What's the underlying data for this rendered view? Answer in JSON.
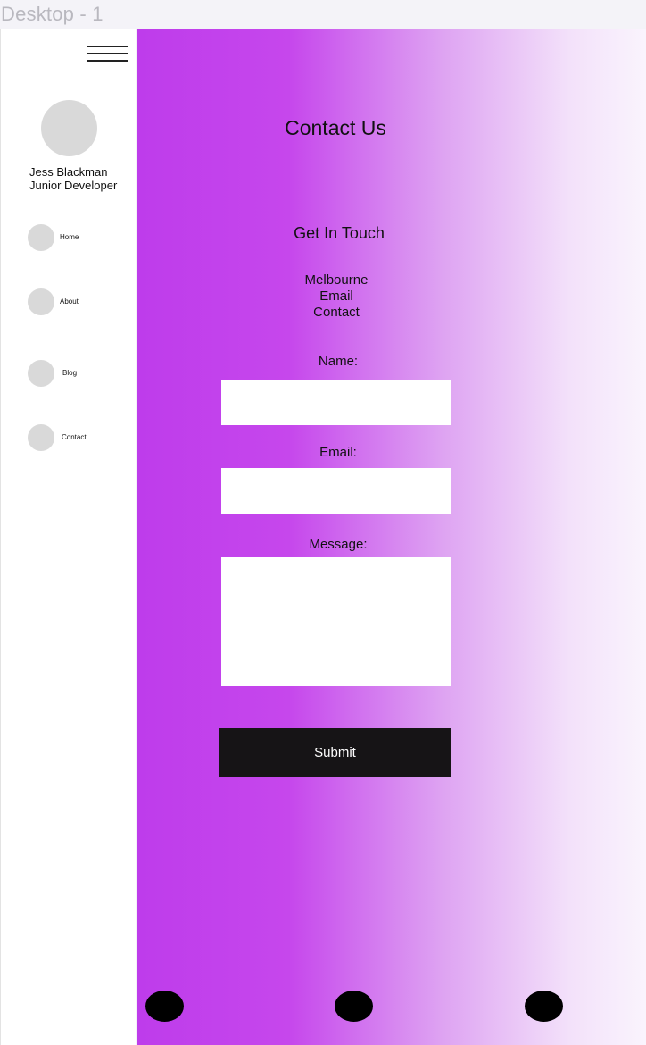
{
  "frame": {
    "label": "Desktop - 1"
  },
  "sidebar": {
    "profile": {
      "name": "Jess Blackman",
      "role": "Junior Developer"
    },
    "nav": [
      {
        "label": "Home",
        "icon": "home-icon"
      },
      {
        "label": "About",
        "icon": "about-icon"
      },
      {
        "label": "Blog",
        "icon": "blog-icon"
      },
      {
        "label": "Contact",
        "icon": "contact-icon"
      }
    ]
  },
  "main": {
    "title": "Contact Us",
    "section_title": "Get In Touch",
    "info": [
      "Melbourne",
      "Email",
      "Contact"
    ],
    "form": {
      "name_label": "Name:",
      "name_value": "",
      "email_label": "Email:",
      "email_value": "",
      "message_label": "Message:",
      "message_value": "",
      "submit_label": "Submit"
    },
    "social": [
      {
        "icon": "social-icon-1"
      },
      {
        "icon": "social-icon-2"
      },
      {
        "icon": "social-icon-3"
      }
    ]
  },
  "colors": {
    "gradient_start": "#be3ceb",
    "gradient_end": "#faf4fd",
    "button": "#161416",
    "placeholder_gray": "#d9d9d9"
  }
}
